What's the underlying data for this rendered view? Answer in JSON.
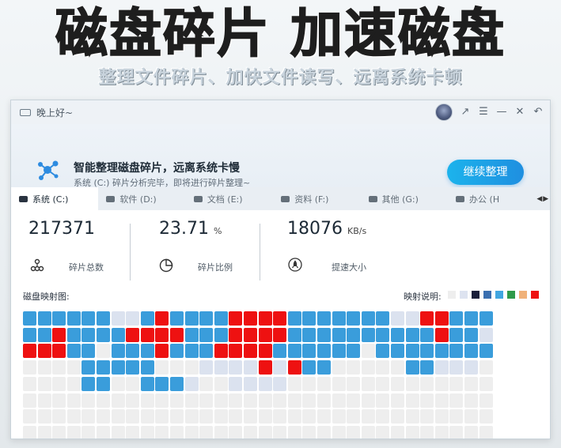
{
  "banner": {
    "title": "磁盘碎片 加速磁盘",
    "subtitle": "整理文件碎片、加快文件读写、远离系统卡顿"
  },
  "window": {
    "greeting": "晚上好~",
    "controls": [
      "share-icon",
      "menu-icon",
      "minimize-icon",
      "close-icon",
      "back-icon"
    ]
  },
  "header": {
    "title": "智能整理磁盘碎片，远离系统卡慢",
    "status": "系统 (C:)  碎片分析完毕，即将进行碎片整理~",
    "continue_label": "继续整理",
    "progress": 1.0
  },
  "tabs": [
    {
      "label": "系统 (C:)",
      "active": true
    },
    {
      "label": "软件 (D:)",
      "active": false
    },
    {
      "label": "文档 (E:)",
      "active": false
    },
    {
      "label": "资料 (F:)",
      "active": false
    },
    {
      "label": "其他 (G:)",
      "active": false
    },
    {
      "label": "办公 (H",
      "active": false
    }
  ],
  "stats": {
    "fragments_total": {
      "value": "217371",
      "label": "碎片总数"
    },
    "fragment_ratio": {
      "value": "23.71",
      "unit": "%",
      "label": "碎片比例"
    },
    "speed": {
      "value": "18076",
      "unit": "KB/s",
      "label": "提速大小"
    }
  },
  "map": {
    "title": "磁盘映射图:",
    "legend_title": "映射说明:",
    "legend_colors": [
      "#eeeeee",
      "#dde3f0",
      "#1a1f3a",
      "#3a6fb0",
      "#41a6e0",
      "#2f9a4a",
      "#f0b27a",
      "#ee1111"
    ],
    "colors": {
      "e": "#eeeeee",
      "l": "#dbe2ef",
      "b": "#3a9ddb",
      "r": "#ee1111"
    },
    "rows": [
      "bbbbbbllbrbbbbrrrrbbbbbbbllrrbbb",
      "bbrbbbbrrrrbbbrrrrbbbbbbbbbbrbbl",
      "rrrbbebbbrbbbrrrrbbbbbbebbbbbbbb",
      "eeeebbbbbeeellllrlrbbeeeeebbllle",
      "eeeebbeebbbleelllleeeeeeeeeeeeee",
      "eeeeeeeeeeeeeeeeeeeeeeeeeeeeeeee",
      "eeeeeeeeeeeeeeeeeeeeeeeeeeeeeeee",
      "eeeeeeeeeeeeeeeeeeeeeeeeeeeeeeee"
    ]
  }
}
